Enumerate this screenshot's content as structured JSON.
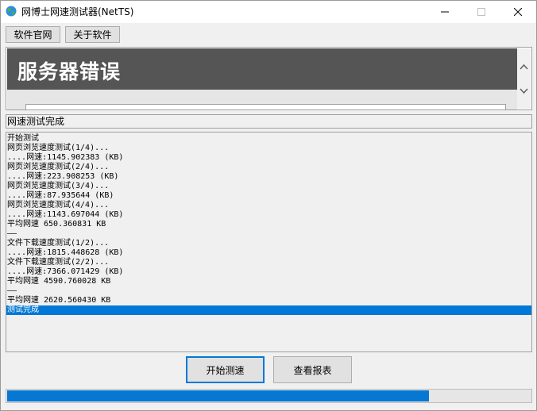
{
  "window": {
    "title": "网博士网速测试器(NetTS)"
  },
  "toolbar": {
    "official_site_label": "软件官网",
    "about_label": "关于软件"
  },
  "browser": {
    "heading": "服务器错误"
  },
  "status": {
    "text": "网速测试完成"
  },
  "log": {
    "lines": [
      "开始测试",
      "网页浏览速度测试(1/4)...",
      "....网速:1145.902383 (KB)",
      "网页浏览速度测试(2/4)...",
      "....网速:223.908253 (KB)",
      "网页浏览速度测试(3/4)...",
      "....网速:87.935644 (KB)",
      "网页浏览速度测试(4/4)...",
      "....网速:1143.697044 (KB)",
      "平均网速 650.360831 KB",
      "——",
      "文件下载速度测试(1/2)...",
      "....网速:1815.448628 (KB)",
      "文件下载速度测试(2/2)...",
      "....网速:7366.071429 (KB)",
      "平均网速 4590.760028 KB",
      "——",
      "平均网速 2620.560430 KB",
      "测试完成"
    ],
    "selected_index": 18
  },
  "buttons": {
    "start_label": "开始测速",
    "report_label": "查看报表"
  },
  "progress": {
    "fraction": 0.806
  },
  "colors": {
    "accent": "#0078d7",
    "banner": "#555555"
  }
}
